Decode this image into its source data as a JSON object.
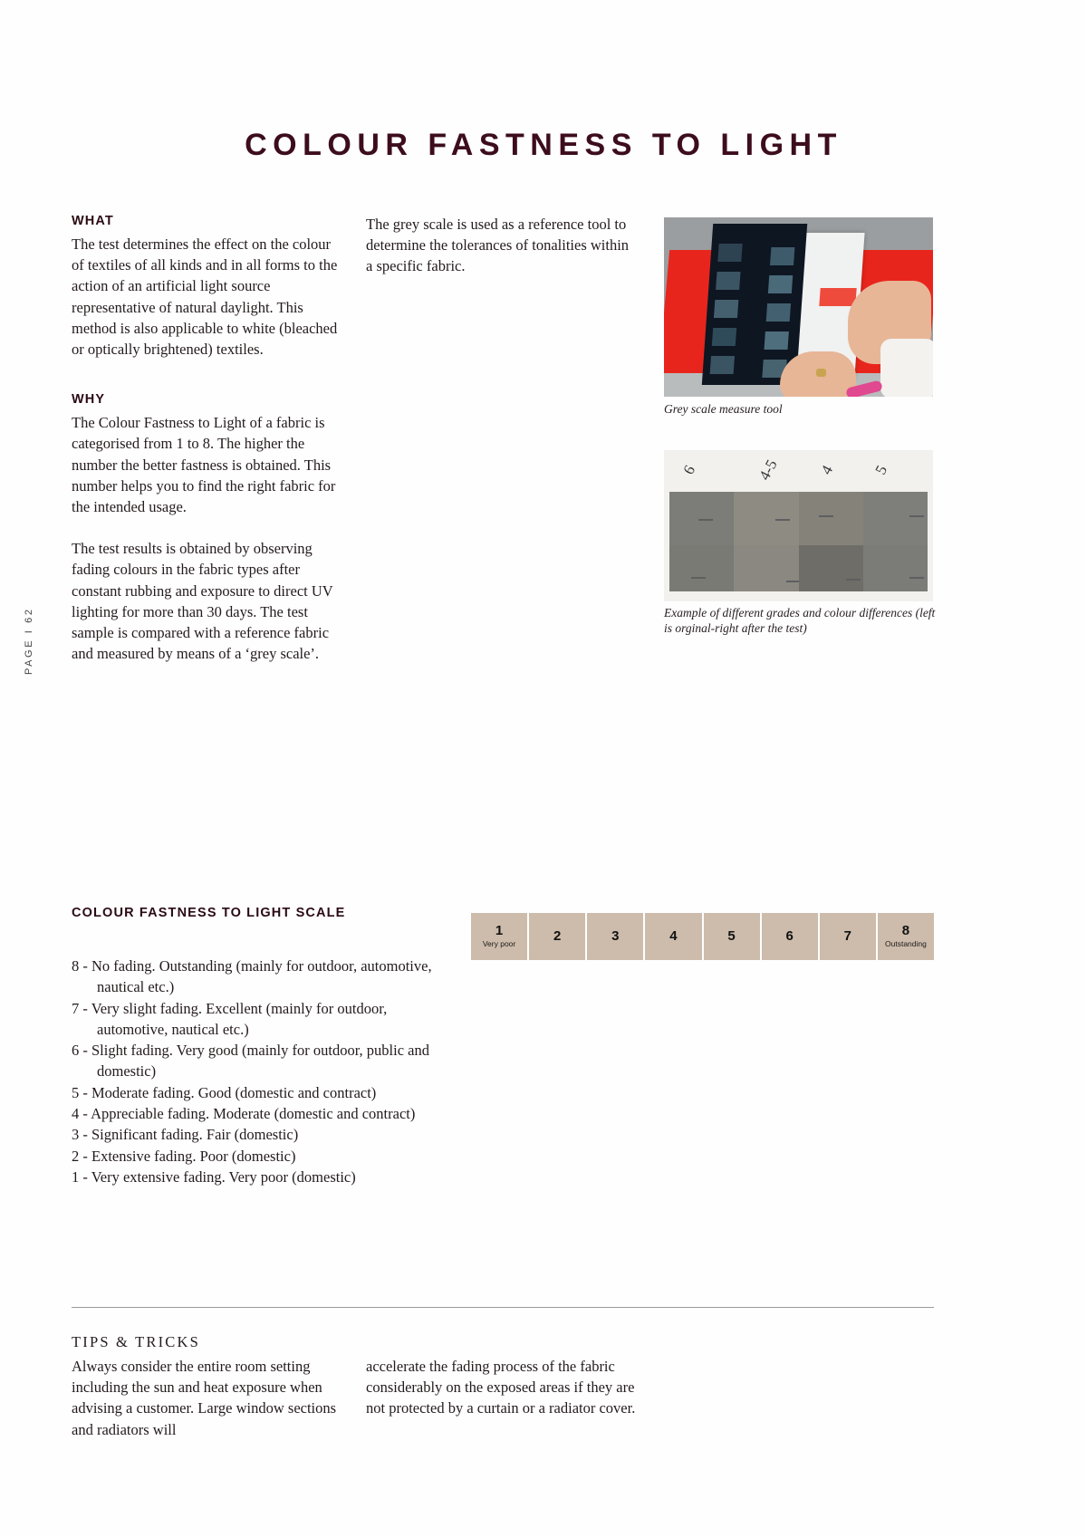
{
  "document": {
    "title": "COLOUR FASTNESS TO LIGHT",
    "page_marker": "PAGE  I 62"
  },
  "sections": {
    "what": {
      "heading": "WHAT",
      "body": "The test determines the effect on the colour of textiles of all kinds and in all forms to the action of an artificial light source representative of natural daylight. This method is also applicable to white (bleached or optically brightened) textiles."
    },
    "why": {
      "heading": "WHY",
      "paragraph_1": "The Colour Fastness to Light of a fabric is categorised from 1 to 8. The higher the number the better fastness is obtained. This number helps you to find the right fabric for the intended usage.",
      "paragraph_2": "The test results is obtained by observing fading colours in the fabric types after constant rubbing and exposure to direct UV lighting for more than 30 days. The test sample is compared with a reference fabric and measured by means of a ‘grey scale’."
    },
    "column_two": {
      "paragraph_1": "The grey scale is used as a reference tool to determine the tolerances of tonalities within a specific fabric."
    }
  },
  "figures": [
    {
      "name": "grey-scale-measure-tool",
      "caption": "Grey scale measure tool"
    },
    {
      "name": "grade-comparison",
      "caption": "Example of different grades and colour differences (left is orginal-right after the test)",
      "swatch_labels": [
        "6",
        "4-5",
        "4",
        "5"
      ]
    }
  ],
  "scale": {
    "heading": "COLOUR FASTNESS TO LIGHT SCALE",
    "cells": [
      {
        "num": "1",
        "sub": "Very poor"
      },
      {
        "num": "2",
        "sub": ""
      },
      {
        "num": "3",
        "sub": ""
      },
      {
        "num": "4",
        "sub": ""
      },
      {
        "num": "5",
        "sub": ""
      },
      {
        "num": "6",
        "sub": ""
      },
      {
        "num": "7",
        "sub": ""
      },
      {
        "num": "8",
        "sub": "Outstanding"
      }
    ],
    "cell_color": "#cdbcab",
    "items": [
      "8 - No fading. Outstanding (mainly for outdoor, automotive, nautical etc.)",
      "7 - Very slight fading. Excellent (mainly for outdoor, automotive, nautical etc.)",
      "6 - Slight fading. Very good (mainly for outdoor, public and domestic)",
      "5 - Moderate fading. Good (domestic and contract)",
      "4 - Appreciable fading. Moderate (domestic and contract)",
      "3 - Significant fading. Fair (domestic)",
      "2 - Extensive fading. Poor (domestic)",
      "1 - Very extensive fading. Very poor (domestic)"
    ]
  },
  "tips": {
    "heading": "TIPS & TRICKS",
    "column_1": "Always consider the entire room setting including the sun and heat exposure when advising a customer. Large window sections and radiators will",
    "column_2": "accelerate the fading process of the fabric considerably on the exposed areas if they are not protected by a curtain or a radiator cover."
  },
  "colors": {
    "title": "#3d0d1d",
    "body_text": "#241a1c",
    "scale_cell": "#cdbcab"
  }
}
